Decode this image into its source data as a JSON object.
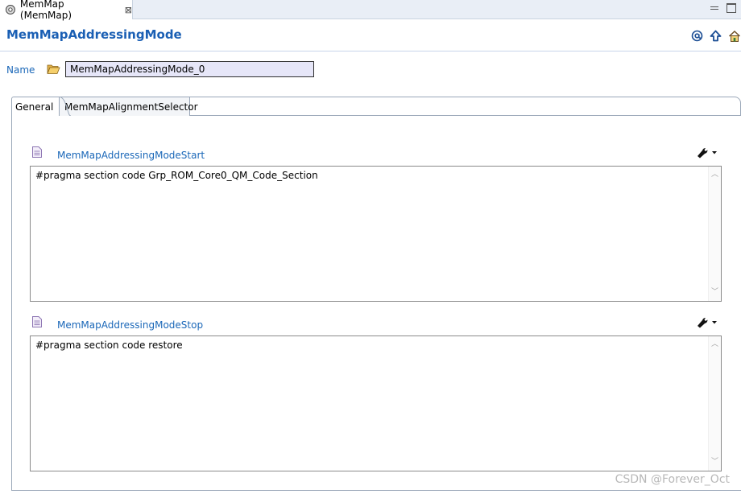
{
  "editor_tab": {
    "label": "MemMap (MemMap)",
    "close_glyph": "⊠"
  },
  "header": {
    "title": "MemMapAddressingMode",
    "icons": [
      "at-icon",
      "up-arrow-icon",
      "home-icon"
    ],
    "accent": "#1a5fb4"
  },
  "name_field": {
    "label": "Name",
    "value": "MemMapAddressingMode_0"
  },
  "tabs": [
    {
      "label": "General",
      "selected": true
    },
    {
      "label": "MemMapAlignmentSelector",
      "selected": false
    }
  ],
  "sections": [
    {
      "label": "MemMapAddressingModeStart",
      "text": "#pragma section code Grp_ROM_Core0_QM_Code_Section"
    },
    {
      "label": "MemMapAddressingModeStop",
      "text": "#pragma section code restore"
    }
  ],
  "watermark": "CSDN @Forever_Oct"
}
